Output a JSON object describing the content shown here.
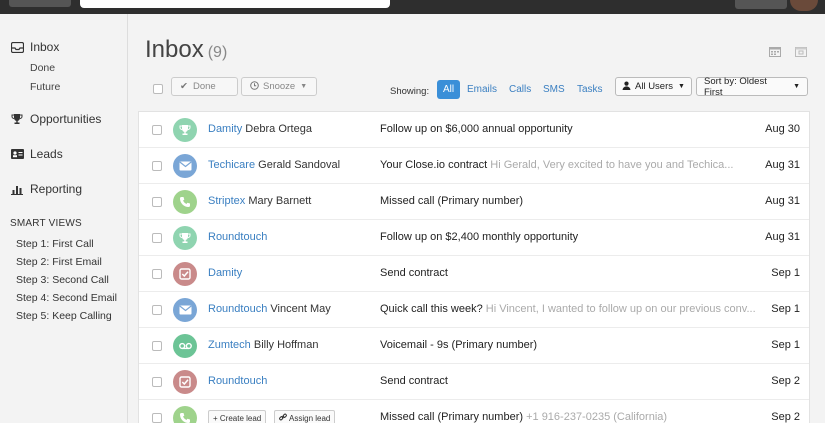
{
  "sidebar": {
    "inbox": "Inbox",
    "done": "Done",
    "future": "Future",
    "opportunities": "Opportunities",
    "leads": "Leads",
    "reporting": "Reporting",
    "smart_views_heading": "SMART VIEWS",
    "smart_views": [
      "Step 1: First Call",
      "Step 2: First Email",
      "Step 3: Second Call",
      "Step 4: Second Email",
      "Step 5: Keep Calling"
    ]
  },
  "header": {
    "title": "Inbox",
    "count": "(9)"
  },
  "toolbar": {
    "done_label": "Done",
    "snooze_label": "Snooze",
    "showing_label": "Showing:",
    "filters": [
      "All",
      "Emails",
      "Calls",
      "SMS",
      "Tasks"
    ],
    "users_label": "All Users",
    "sort_label": "Sort by: Oldest First"
  },
  "rows": [
    {
      "company": "Damity",
      "contact": "Debra Ortega",
      "subject": "Follow up on $6,000 annual opportunity",
      "preview": "",
      "date": "Aug 30",
      "type": "opportunity",
      "color": "#8fd4b0"
    },
    {
      "company": "Techicare",
      "contact": "Gerald Sandoval",
      "subject": "Your Close.io contract",
      "preview": "Hi Gerald, Very excited to have you and Techica...",
      "date": "Aug 31",
      "type": "email",
      "color": "#7aa6d6"
    },
    {
      "company": "Striptex",
      "contact": "Mary Barnett",
      "subject": "Missed call (Primary number)",
      "preview": "",
      "date": "Aug 31",
      "type": "call",
      "color": "#9fd38c"
    },
    {
      "company": "Roundtouch",
      "contact": "",
      "subject": "Follow up on $2,400 monthly opportunity",
      "preview": "",
      "date": "Aug 31",
      "type": "opportunity",
      "color": "#8fd4b0"
    },
    {
      "company": "Damity",
      "contact": "",
      "subject": "Send contract",
      "preview": "",
      "date": "Sep 1",
      "type": "task",
      "color": "#c98a8a"
    },
    {
      "company": "Roundtouch",
      "contact": "Vincent May",
      "subject": "Quick call this week?",
      "preview": "Hi Vincent, I wanted to follow up on our previous conv...",
      "date": "Sep 1",
      "type": "email",
      "color": "#7aa6d6"
    },
    {
      "company": "Zumtech",
      "contact": "Billy Hoffman",
      "subject": "Voicemail - 9s (Primary number)",
      "preview": "",
      "date": "Sep 1",
      "type": "voicemail",
      "color": "#6cc496"
    },
    {
      "company": "Roundtouch",
      "contact": "",
      "subject": "Send contract",
      "preview": "",
      "date": "Sep 2",
      "type": "task",
      "color": "#c98a8a"
    },
    {
      "company": "",
      "contact": "",
      "subject": "Missed call (Primary number)",
      "preview": "+1 916-237-0235 (California)",
      "date": "Sep 2",
      "type": "call",
      "color": "#9fd38c"
    }
  ],
  "last_row_actions": {
    "create_lead": "+ Create lead",
    "assign_lead": "Assign lead"
  },
  "colors": {
    "accent": "#3a8fd8",
    "link": "#3a7fc1"
  }
}
